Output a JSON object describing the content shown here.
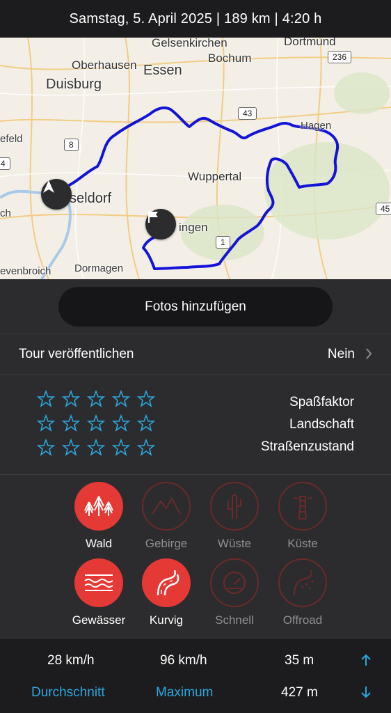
{
  "header": {
    "title": "Samstag, 5. April 2025 | 189 km | 4:20 h"
  },
  "map": {
    "labels": {
      "gelsenkirchen": "Gelsenkirchen",
      "dortmund": "Dortmund",
      "oberhausen": "Oberhausen",
      "bochum": "Bochum",
      "essen": "Essen",
      "duisburg": "Duisburg",
      "hagen": "Hagen",
      "efeld": "efeld",
      "wuppertal": "Wuppertal",
      "duesseldorf": "seldorf",
      "solingen": "ingen",
      "ch": "ch",
      "dormagen": "Dormagen",
      "grevenbroich": "evenbroich"
    },
    "shields": {
      "s236": "236",
      "s43": "43",
      "s8": "8",
      "s4": "4",
      "s1": "1",
      "s45": "45"
    },
    "route_color": "#1414d8"
  },
  "photos": {
    "button_label": "Fotos hinzufügen"
  },
  "publish": {
    "label": "Tour veröffentlichen",
    "value": "Nein"
  },
  "ratings": [
    {
      "label": "Spaßfaktor",
      "stars": 0,
      "max": 5
    },
    {
      "label": "Landschaft",
      "stars": 0,
      "max": 5
    },
    {
      "label": "Straßenzustand",
      "stars": 0,
      "max": 5
    }
  ],
  "tags": [
    {
      "label": "Wald",
      "active": true,
      "icon": "forest-icon"
    },
    {
      "label": "Gebirge",
      "active": false,
      "icon": "mountains-icon"
    },
    {
      "label": "Wüste",
      "active": false,
      "icon": "cactus-icon"
    },
    {
      "label": "Küste",
      "active": false,
      "icon": "lighthouse-icon"
    },
    {
      "label": "Gewässer",
      "active": true,
      "icon": "water-icon"
    },
    {
      "label": "Kurvig",
      "active": true,
      "icon": "curvy-road-icon"
    },
    {
      "label": "Schnell",
      "active": false,
      "icon": "speedometer-icon"
    },
    {
      "label": "Offroad",
      "active": false,
      "icon": "offroad-icon"
    }
  ],
  "stats": {
    "avg_speed": "28 km/h",
    "avg_label": "Durchschnitt",
    "max_speed": "96 km/h",
    "max_label": "Maximum",
    "ascent": "35 m",
    "descent": "427 m"
  },
  "colors": {
    "accent": "#2aa8e0",
    "tag_active": "#e53935",
    "tag_inactive_border": "#6b2a2a"
  }
}
